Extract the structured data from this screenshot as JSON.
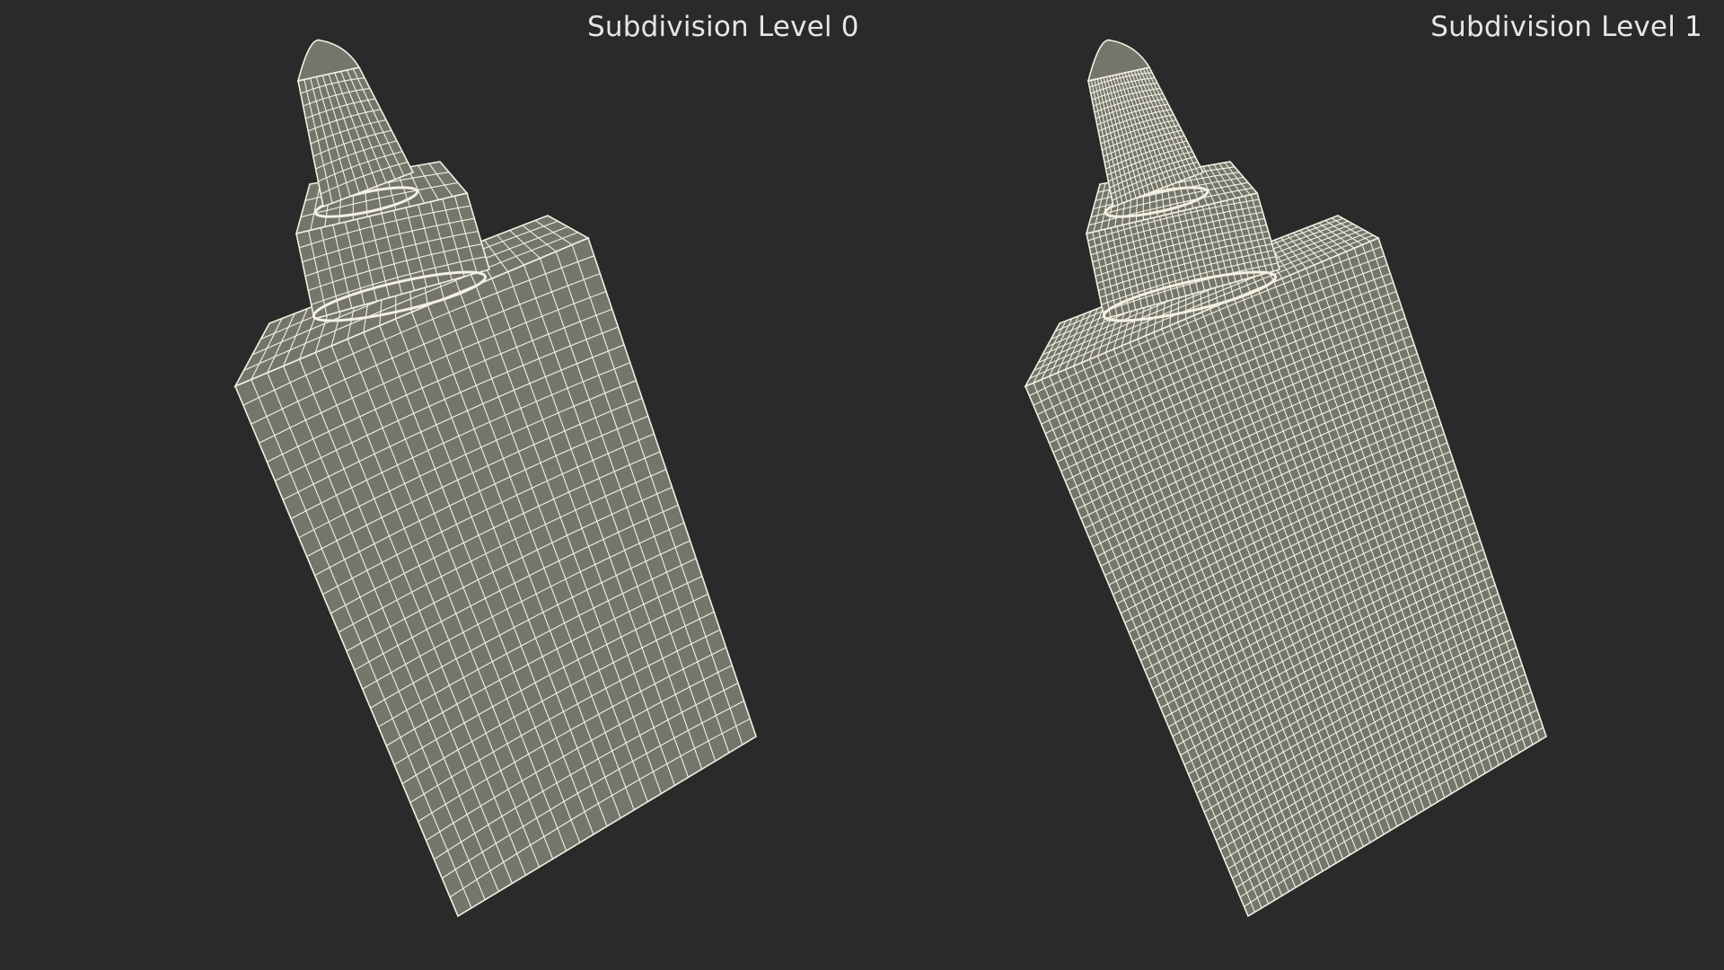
{
  "viewports": [
    {
      "label": "Subdivision Level 0",
      "level": 0
    },
    {
      "label": "Subdivision Level 1",
      "level": 1
    }
  ],
  "colors": {
    "background": "#2a2a2a",
    "surface": "#75756b",
    "wire": "#f2f1e2",
    "label": "#e6e6e6"
  }
}
